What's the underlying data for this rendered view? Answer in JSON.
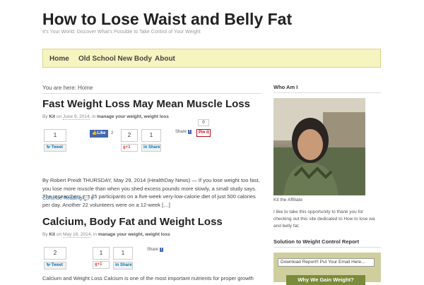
{
  "site": {
    "title": "How to Lose Waist and Belly Fat",
    "tagline": "It's Your World: Discover What's Possible to Take Control of Your Weight"
  },
  "nav": {
    "items": [
      {
        "label": "Home"
      },
      {
        "label": "Old School New Body"
      },
      {
        "label": "About"
      }
    ]
  },
  "breadcrumb": "You are here: Home",
  "posts": [
    {
      "title": "Fast Weight Loss May Mean Muscle Loss",
      "by": "By",
      "author": "Kit",
      "on": "on",
      "date": "June 9, 2014",
      "in": "in",
      "categories": "manage your weight, weight loss",
      "tweet_count": "1",
      "tweet_label": "Tweet",
      "like_label": "Like",
      "like_count": "2",
      "gplus_count": "2",
      "gplus_label": "g+1",
      "linkedin_count": "1",
      "linkedin_label": "Share",
      "fb_share_label": "Share",
      "pin_count": "0",
      "pin_label": "Pin it",
      "excerpt": "By Robert Preidt THURSDAY, May 29, 2014 (HealthDay News) — If you lose weight too fast, you lose more muscle than when you shed excess pounds more slowly, a small study says. The researchers put 25 participants on a five-week very-low-calorie diet of just 500 calories per day. Another 22 volunteers were on a 12-week […]",
      "continue_label": "Continue Reading",
      "comment_count": "0"
    },
    {
      "title": "Calcium, Body Fat and Weight Loss",
      "by": "By",
      "author": "Kit",
      "on": "on",
      "date": "May 18, 2014",
      "in": "in",
      "categories": "manage your weight, weight loss",
      "tweet_count": "2",
      "tweet_label": "Tweet",
      "gplus_count": "1",
      "gplus_label": "g+1",
      "linkedin_count": "1",
      "linkedin_label": "Share",
      "fb_share_label": "Share",
      "excerpt": "Calcium and Weight Loss Calcium is one of the most important nutrients for proper growth"
    }
  ],
  "sidebar": {
    "who_am_i": "Who Am I",
    "caption": "Kit the Affiliate",
    "intro": "I like to take this opportunity to thank you for checking out this site dedicated to How to lose wa and belly fat.",
    "solution_title": "Solution to Weight Control Report",
    "email_placeholder": "Download Report!! Put Your Email Here...",
    "cta_label": "Why We Gain Weight?"
  },
  "colors": {
    "nav_bg": "#f6f4bf",
    "link": "#2a7aab",
    "sidebar_box": "#cfcf9e"
  }
}
